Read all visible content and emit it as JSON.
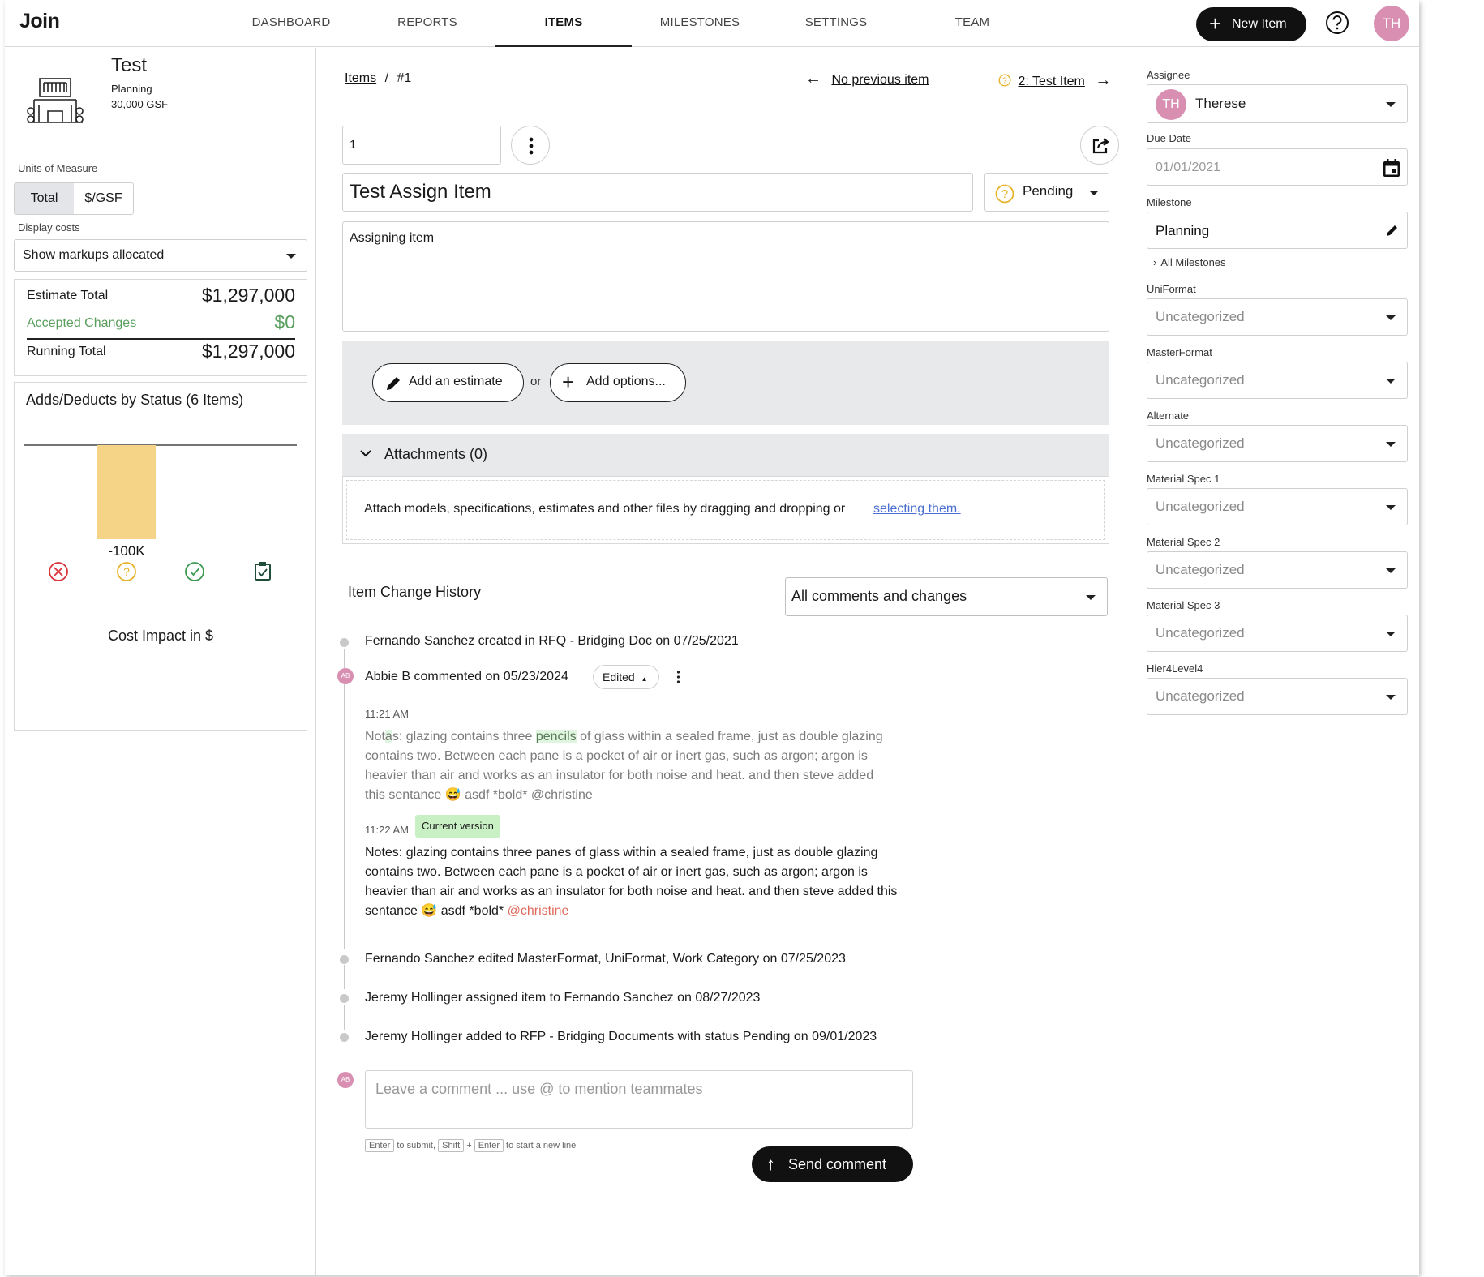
{
  "nav": {
    "logo": "Join",
    "tabs": [
      "DASHBOARD",
      "REPORTS",
      "ITEMS",
      "MILESTONES",
      "SETTINGS",
      "TEAM"
    ],
    "active_tab": "ITEMS",
    "new_item_label": "New Item",
    "user_initials": "TH"
  },
  "project": {
    "name": "Test",
    "phase": "Planning",
    "gsf": "30,000 GSF",
    "units_label": "Units of Measure",
    "units_options": [
      "Total",
      "$/GSF"
    ],
    "display_costs_label": "Display costs",
    "display_costs_value": "Show markups allocated"
  },
  "totals": {
    "estimate_label": "Estimate Total",
    "estimate_value": "$1,297,000",
    "accepted_label": "Accepted Changes",
    "accepted_value": "$0",
    "running_label": "Running Total",
    "running_value": "$1,297,000"
  },
  "chart_data": {
    "type": "bar",
    "title": "Adds/Deducts by Status (6 Items)",
    "categories": [
      "Rejected",
      "Pending",
      "Accepted",
      "Incorporated"
    ],
    "values": [
      0,
      -100000,
      0,
      0
    ],
    "bar_label": "-100K",
    "xlabel": "Cost Impact in $",
    "colors": {
      "pending_bar": "#f5d487",
      "rejected": "#d9343a",
      "pending": "#e7b32a",
      "accepted": "#3c9a50",
      "incorporated": "#1f4d3a"
    }
  },
  "item": {
    "breadcrumb_root": "Items",
    "breadcrumb_current": "#1",
    "prev_link": "No previous item",
    "next_link": "2: Test Item",
    "number": "1",
    "title": "Test Assign Item",
    "status": "Pending",
    "description": "Assigning item",
    "add_estimate_label": "Add an estimate",
    "or_label": "or",
    "add_options_label": "Add options...",
    "attachments_label": "Attachments (0)",
    "attach_text": "Attach models, specifications, estimates and other files by dragging and dropping or",
    "attach_link": "selecting them."
  },
  "history": {
    "title": "Item Change History",
    "filter_value": "All comments and changes",
    "events": [
      "Fernando Sanchez created in RFQ - Bridging Doc on 07/25/2021",
      "Fernando Sanchez edited MasterFormat, UniFormat, Work Category on 07/25/2023",
      "Jeremy Hollinger assigned item to Fernando Sanchez on 08/27/2023",
      "Jeremy Hollinger added to RFP - Bridging Documents with status Pending on 09/01/2023"
    ],
    "comment": {
      "avatar": "AB",
      "header": "Abbie B commented on 05/23/2024",
      "edited_label": "Edited",
      "old_time": "11:21 AM",
      "old_text": {
        "p1": "Not",
        "p2": "a",
        "p3": "s: glazing contains three ",
        "p4": "pencils",
        "p5": " of glass within a sealed frame, just as double glazing contains two. Between each pane is a pocket of air or inert gas, such as argon; argon is heavier than air and works as an insulator for both noise and heat. and then steve added this sentance 😅 asdf *bold* @christine"
      },
      "new_time": "11:22 AM",
      "current_label": "Current version",
      "new_text": "Notes: glazing contains three panes of glass within a sealed frame, just as double glazing contains two. Between each pane is a pocket of air or inert gas, such as argon; argon is heavier than air and works as an insulator for both noise and heat. and then steve added this sentance 😅 asdf *bold* ",
      "mention": "@christine"
    },
    "composer_avatar": "AB",
    "composer_placeholder": "Leave a comment ... use @ to mention teammates",
    "hint_enter": "Enter",
    "hint_submit": "to submit,",
    "hint_shift": "Shift",
    "hint_plus": "+",
    "hint_newline": "to start a new line",
    "send_label": "Send comment"
  },
  "sidebar": {
    "assignee_label": "Assignee",
    "assignee_initials": "TH",
    "assignee_name": "Therese",
    "due_label": "Due Date",
    "due_placeholder": "01/01/2021",
    "milestone_label": "Milestone",
    "milestone_value": "Planning",
    "all_milestones": "All Milestones",
    "fields": [
      {
        "label": "UniFormat",
        "value": "Uncategorized"
      },
      {
        "label": "MasterFormat",
        "value": "Uncategorized"
      },
      {
        "label": "Alternate",
        "value": "Uncategorized"
      },
      {
        "label": "Material Spec 1",
        "value": "Uncategorized"
      },
      {
        "label": "Material Spec 2",
        "value": "Uncategorized"
      },
      {
        "label": "Material Spec 3",
        "value": "Uncategorized"
      },
      {
        "label": "Hier4Level4",
        "value": "Uncategorized"
      }
    ]
  }
}
